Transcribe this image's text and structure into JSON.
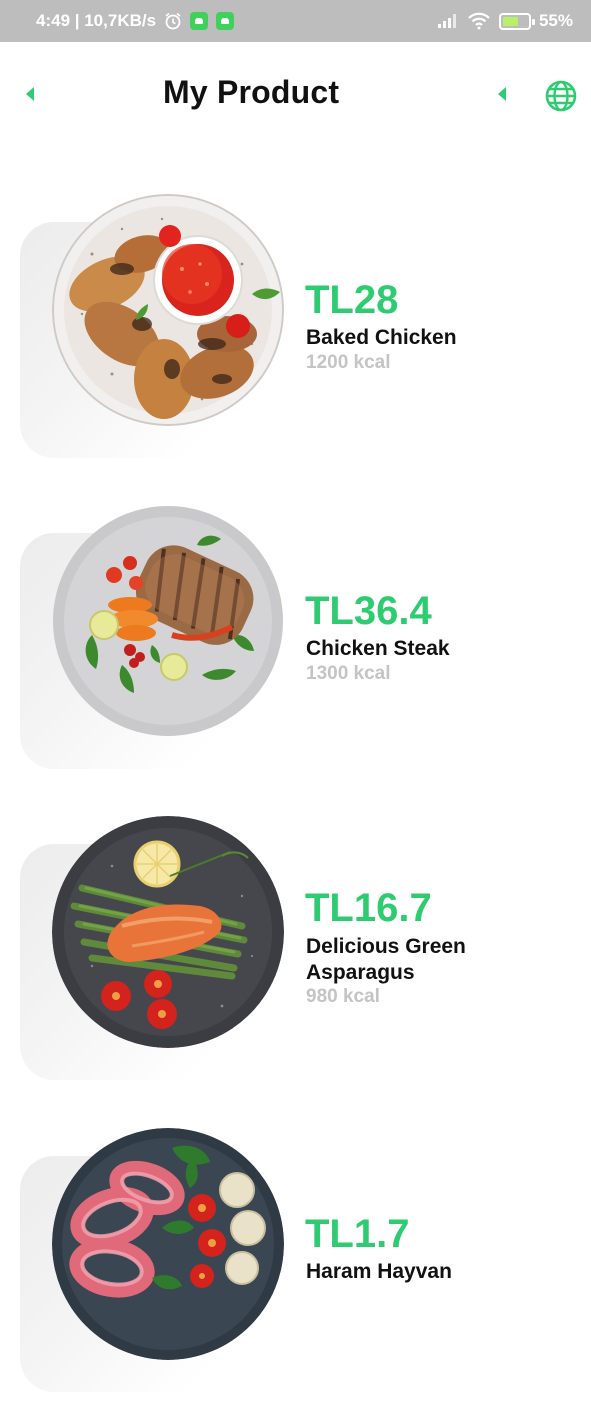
{
  "status_bar": {
    "time_speed": "4:49 | 10,7KB/s",
    "battery": "55%"
  },
  "header": {
    "title": "My Product",
    "back_icon": "back-triangle-icon",
    "prev_icon": "back-triangle-icon",
    "language_icon": "globe-icon"
  },
  "products": [
    {
      "price": "TL28",
      "name": "Baked Chicken",
      "kcal": "1200 kcal"
    },
    {
      "price": "TL36.4",
      "name": "Chicken Steak",
      "kcal": "1300 kcal"
    },
    {
      "price": "TL16.7",
      "name": "Delicious Green Asparagus",
      "kcal": "980 kcal"
    },
    {
      "price": "TL1.7",
      "name": "Haram Hayvan",
      "kcal": ""
    }
  ],
  "colors": {
    "accent": "#2ecc71",
    "muted": "#c4c4c4",
    "status_bar": "#bdbdbd"
  }
}
